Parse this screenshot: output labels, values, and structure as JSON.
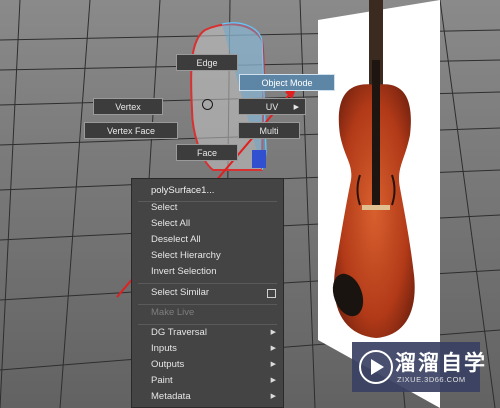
{
  "hotbox": {
    "edge": "Edge",
    "object_mode": "Object Mode",
    "vertex": "Vertex",
    "uv": "UV",
    "vertex_face": "Vertex Face",
    "multi": "Multi",
    "face": "Face"
  },
  "context_menu": {
    "title": "polySurface1...",
    "items": [
      {
        "label": "Select"
      },
      {
        "label": "Select All"
      },
      {
        "label": "Deselect All"
      },
      {
        "label": "Select Hierarchy"
      },
      {
        "label": "Invert Selection"
      },
      {
        "label": "Select Similar"
      },
      {
        "label": "Make Live"
      },
      {
        "label": "DG Traversal"
      },
      {
        "label": "Inputs"
      },
      {
        "label": "Outputs"
      },
      {
        "label": "Paint"
      },
      {
        "label": "Metadata"
      }
    ]
  },
  "watermark": {
    "name": "溜溜自学",
    "url": "ZIXUE.3D66.COM"
  },
  "colors": {
    "viewport_bg": "#6a6a6a",
    "grid_line": "#2e2e2e",
    "menu_bg": "#444444",
    "hotbox_active": "#5d86a6",
    "drag_line": "#e02020",
    "violin_body": "#b8391a"
  },
  "icons": {
    "submenu": "triangle-right-icon",
    "option_box": "option-box-icon"
  }
}
